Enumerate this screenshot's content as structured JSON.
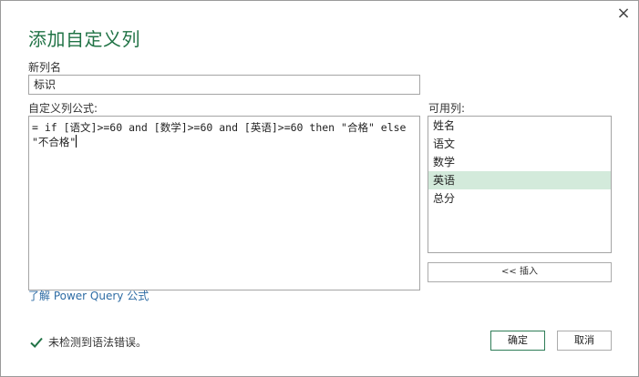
{
  "dialog": {
    "title": "添加自定义列",
    "close_icon": "×"
  },
  "new_column": {
    "label": "新列名",
    "value": "标识"
  },
  "formula": {
    "label": "自定义列公式:",
    "value": "= if [语文]>=60 and [数学]>=60 and [英语]>=60 then \"合格\" else \"不合格\""
  },
  "available_columns": {
    "label": "可用列:",
    "items": [
      "姓名",
      "语文",
      "数学",
      "英语",
      "总分"
    ],
    "selected": "英语"
  },
  "insert_button": "<< 插入",
  "learn_link": "了解 Power Query 公式",
  "status": {
    "icon": "check-icon",
    "text": "未检测到语法错误。",
    "color": "#217346"
  },
  "buttons": {
    "ok": "确定",
    "cancel": "取消"
  },
  "colors": {
    "title": "#217346",
    "selection": "#d3eadb",
    "link": "#2e6ca4"
  }
}
